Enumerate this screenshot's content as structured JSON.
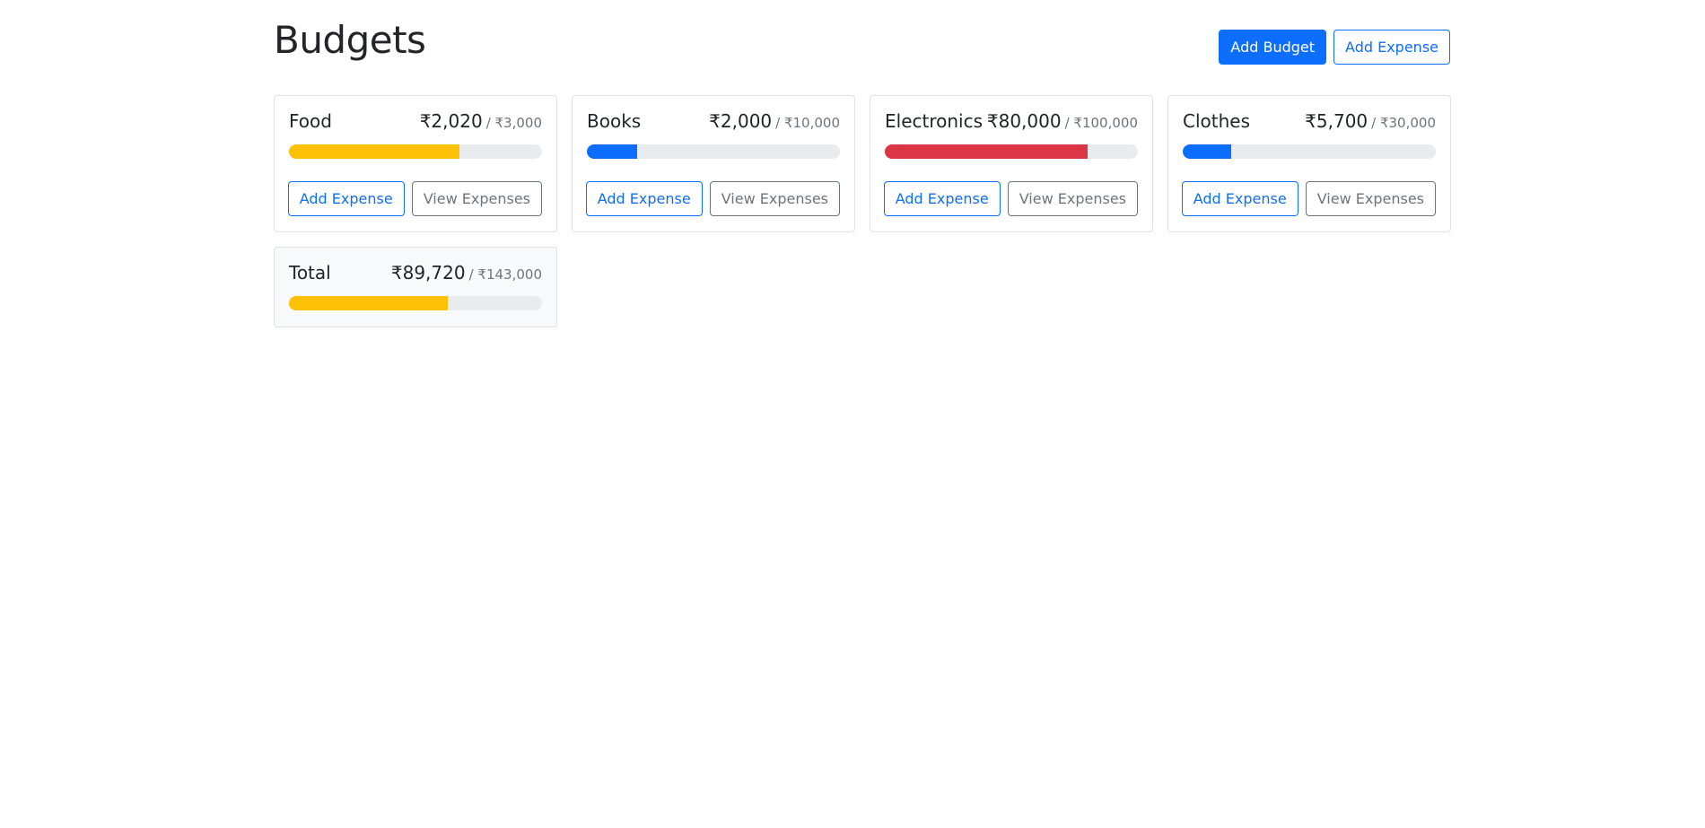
{
  "page": {
    "title": "Budgets"
  },
  "header": {
    "add_budget_label": "Add Budget",
    "add_expense_label": "Add Expense"
  },
  "colors": {
    "primary": "#0d6efd",
    "warning": "#ffc107",
    "danger": "#dc3545",
    "track": "#e9ecef"
  },
  "budgets": [
    {
      "name": "Food",
      "amount": "₹2,020",
      "max": "/ ₹3,000",
      "progress": 0.673,
      "bar_color": "#ffc107",
      "add_label": "Add Expense",
      "view_label": "View Expenses"
    },
    {
      "name": "Books",
      "amount": "₹2,000",
      "max": "/ ₹10,000",
      "progress": 0.2,
      "bar_color": "#0d6efd",
      "add_label": "Add Expense",
      "view_label": "View Expenses"
    },
    {
      "name": "Electronics",
      "amount": "₹80,000",
      "max": "/ ₹100,000",
      "progress": 0.8,
      "bar_color": "#dc3545",
      "add_label": "Add Expense",
      "view_label": "View Expenses"
    },
    {
      "name": "Clothes",
      "amount": "₹5,700",
      "max": "/ ₹30,000",
      "progress": 0.19,
      "bar_color": "#0d6efd",
      "add_label": "Add Expense",
      "view_label": "View Expenses"
    }
  ],
  "total": {
    "name": "Total",
    "amount": "₹89,720",
    "max": "/ ₹143,000",
    "progress": 0.627,
    "bar_color": "#ffc107"
  }
}
